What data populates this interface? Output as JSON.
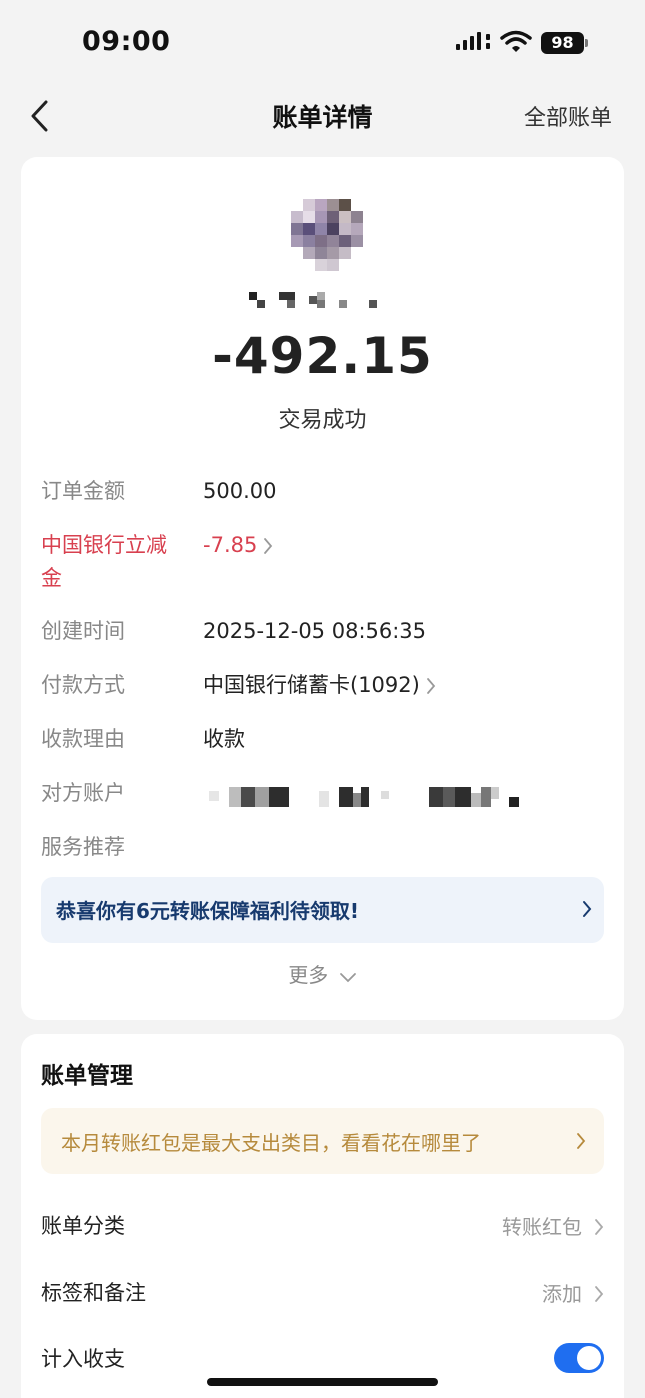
{
  "status_bar": {
    "time": "09:00",
    "battery": "98"
  },
  "nav": {
    "title": "账单详情",
    "right_link": "全部账单"
  },
  "summary": {
    "amount": "-492.15",
    "status": "交易成功"
  },
  "details": {
    "order_amount_label": "订单金额",
    "order_amount_value": "500.00",
    "discount_label": "中国银行立减金",
    "discount_value": "-7.85",
    "created_label": "创建时间",
    "created_value": "2025-12-05 08:56:35",
    "payment_label": "付款方式",
    "payment_value": "中国银行储蓄卡(1092)",
    "reason_label": "收款理由",
    "reason_value": "收款",
    "counterparty_label": "对方账户",
    "service_label": "服务推荐"
  },
  "promo": {
    "text": "恭喜你有6元转账保障福利待领取!"
  },
  "more": {
    "label": "更多"
  },
  "manage": {
    "title": "账单管理",
    "tip": "本月转账红包是最大支出类目，看看花在哪里了",
    "category_label": "账单分类",
    "category_value": "转账红包",
    "tags_label": "标签和备注",
    "tags_value": "添加",
    "income_label": "计入收支"
  },
  "colors": {
    "accent_red": "#d8404f",
    "toggle_blue": "#1f6ef0",
    "promo_text": "#173a6e",
    "tip_text": "#b68a3c"
  },
  "icons": [
    "back-icon",
    "signal-icon",
    "wifi-icon",
    "battery-icon",
    "chevron-right-icon",
    "chevron-down-icon"
  ]
}
